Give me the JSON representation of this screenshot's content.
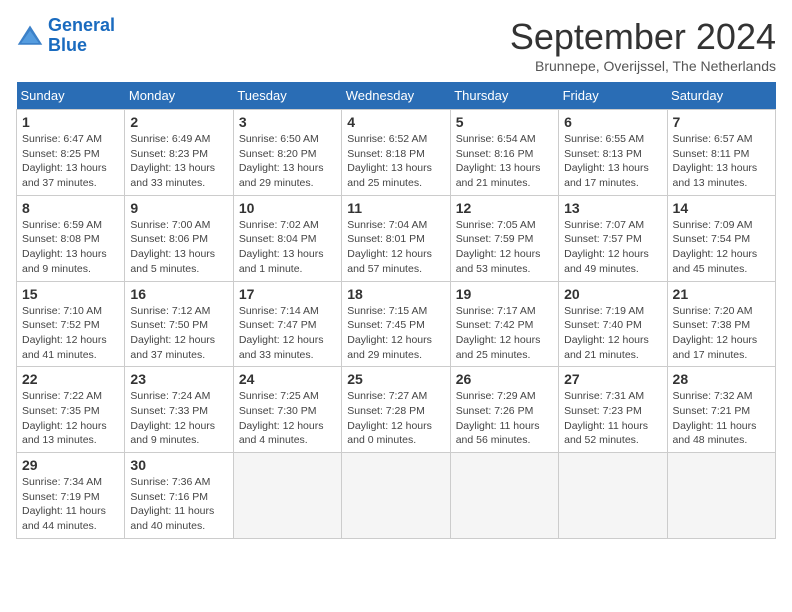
{
  "header": {
    "logo_line1": "General",
    "logo_line2": "Blue",
    "month_title": "September 2024",
    "subtitle": "Brunnepe, Overijssel, The Netherlands"
  },
  "days_of_week": [
    "Sunday",
    "Monday",
    "Tuesday",
    "Wednesday",
    "Thursday",
    "Friday",
    "Saturday"
  ],
  "weeks": [
    [
      {
        "num": "1",
        "info": "Sunrise: 6:47 AM\nSunset: 8:25 PM\nDaylight: 13 hours\nand 37 minutes."
      },
      {
        "num": "2",
        "info": "Sunrise: 6:49 AM\nSunset: 8:23 PM\nDaylight: 13 hours\nand 33 minutes."
      },
      {
        "num": "3",
        "info": "Sunrise: 6:50 AM\nSunset: 8:20 PM\nDaylight: 13 hours\nand 29 minutes."
      },
      {
        "num": "4",
        "info": "Sunrise: 6:52 AM\nSunset: 8:18 PM\nDaylight: 13 hours\nand 25 minutes."
      },
      {
        "num": "5",
        "info": "Sunrise: 6:54 AM\nSunset: 8:16 PM\nDaylight: 13 hours\nand 21 minutes."
      },
      {
        "num": "6",
        "info": "Sunrise: 6:55 AM\nSunset: 8:13 PM\nDaylight: 13 hours\nand 17 minutes."
      },
      {
        "num": "7",
        "info": "Sunrise: 6:57 AM\nSunset: 8:11 PM\nDaylight: 13 hours\nand 13 minutes."
      }
    ],
    [
      {
        "num": "8",
        "info": "Sunrise: 6:59 AM\nSunset: 8:08 PM\nDaylight: 13 hours\nand 9 minutes."
      },
      {
        "num": "9",
        "info": "Sunrise: 7:00 AM\nSunset: 8:06 PM\nDaylight: 13 hours\nand 5 minutes."
      },
      {
        "num": "10",
        "info": "Sunrise: 7:02 AM\nSunset: 8:04 PM\nDaylight: 13 hours\nand 1 minute."
      },
      {
        "num": "11",
        "info": "Sunrise: 7:04 AM\nSunset: 8:01 PM\nDaylight: 12 hours\nand 57 minutes."
      },
      {
        "num": "12",
        "info": "Sunrise: 7:05 AM\nSunset: 7:59 PM\nDaylight: 12 hours\nand 53 minutes."
      },
      {
        "num": "13",
        "info": "Sunrise: 7:07 AM\nSunset: 7:57 PM\nDaylight: 12 hours\nand 49 minutes."
      },
      {
        "num": "14",
        "info": "Sunrise: 7:09 AM\nSunset: 7:54 PM\nDaylight: 12 hours\nand 45 minutes."
      }
    ],
    [
      {
        "num": "15",
        "info": "Sunrise: 7:10 AM\nSunset: 7:52 PM\nDaylight: 12 hours\nand 41 minutes."
      },
      {
        "num": "16",
        "info": "Sunrise: 7:12 AM\nSunset: 7:50 PM\nDaylight: 12 hours\nand 37 minutes."
      },
      {
        "num": "17",
        "info": "Sunrise: 7:14 AM\nSunset: 7:47 PM\nDaylight: 12 hours\nand 33 minutes."
      },
      {
        "num": "18",
        "info": "Sunrise: 7:15 AM\nSunset: 7:45 PM\nDaylight: 12 hours\nand 29 minutes."
      },
      {
        "num": "19",
        "info": "Sunrise: 7:17 AM\nSunset: 7:42 PM\nDaylight: 12 hours\nand 25 minutes."
      },
      {
        "num": "20",
        "info": "Sunrise: 7:19 AM\nSunset: 7:40 PM\nDaylight: 12 hours\nand 21 minutes."
      },
      {
        "num": "21",
        "info": "Sunrise: 7:20 AM\nSunset: 7:38 PM\nDaylight: 12 hours\nand 17 minutes."
      }
    ],
    [
      {
        "num": "22",
        "info": "Sunrise: 7:22 AM\nSunset: 7:35 PM\nDaylight: 12 hours\nand 13 minutes."
      },
      {
        "num": "23",
        "info": "Sunrise: 7:24 AM\nSunset: 7:33 PM\nDaylight: 12 hours\nand 9 minutes."
      },
      {
        "num": "24",
        "info": "Sunrise: 7:25 AM\nSunset: 7:30 PM\nDaylight: 12 hours\nand 4 minutes."
      },
      {
        "num": "25",
        "info": "Sunrise: 7:27 AM\nSunset: 7:28 PM\nDaylight: 12 hours\nand 0 minutes."
      },
      {
        "num": "26",
        "info": "Sunrise: 7:29 AM\nSunset: 7:26 PM\nDaylight: 11 hours\nand 56 minutes."
      },
      {
        "num": "27",
        "info": "Sunrise: 7:31 AM\nSunset: 7:23 PM\nDaylight: 11 hours\nand 52 minutes."
      },
      {
        "num": "28",
        "info": "Sunrise: 7:32 AM\nSunset: 7:21 PM\nDaylight: 11 hours\nand 48 minutes."
      }
    ],
    [
      {
        "num": "29",
        "info": "Sunrise: 7:34 AM\nSunset: 7:19 PM\nDaylight: 11 hours\nand 44 minutes."
      },
      {
        "num": "30",
        "info": "Sunrise: 7:36 AM\nSunset: 7:16 PM\nDaylight: 11 hours\nand 40 minutes."
      },
      null,
      null,
      null,
      null,
      null
    ]
  ]
}
